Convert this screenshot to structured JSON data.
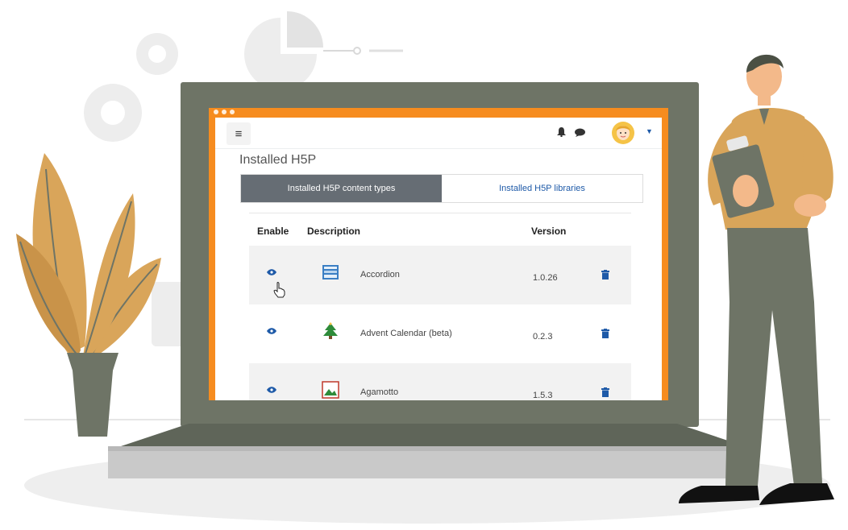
{
  "navbar": {
    "menu_icon": "hamburger-icon",
    "notification_icon": "bell-icon",
    "messages_icon": "chat-icon",
    "user_icon": "avatar",
    "menu_glyph": "≡"
  },
  "page": {
    "title": "Installed H5P"
  },
  "tabs": [
    {
      "label": "Installed H5P content types",
      "active": true
    },
    {
      "label": "Installed H5P libraries",
      "active": false
    }
  ],
  "table": {
    "headers": {
      "enable": "Enable",
      "description": "Description",
      "version": "Version"
    },
    "rows": [
      {
        "name": "Accordion",
        "version": "1.0.26",
        "icon": "accordion-icon"
      },
      {
        "name": "Advent Calendar (beta)",
        "version": "0.2.3",
        "icon": "tree-icon"
      },
      {
        "name": "Agamotto",
        "version": "1.5.3",
        "icon": "image-icon"
      }
    ]
  },
  "colors": {
    "screen_border": "#f68c1f",
    "active_tab": "#666d74",
    "link": "#1e5aa8",
    "laptop": "#6e7466"
  }
}
